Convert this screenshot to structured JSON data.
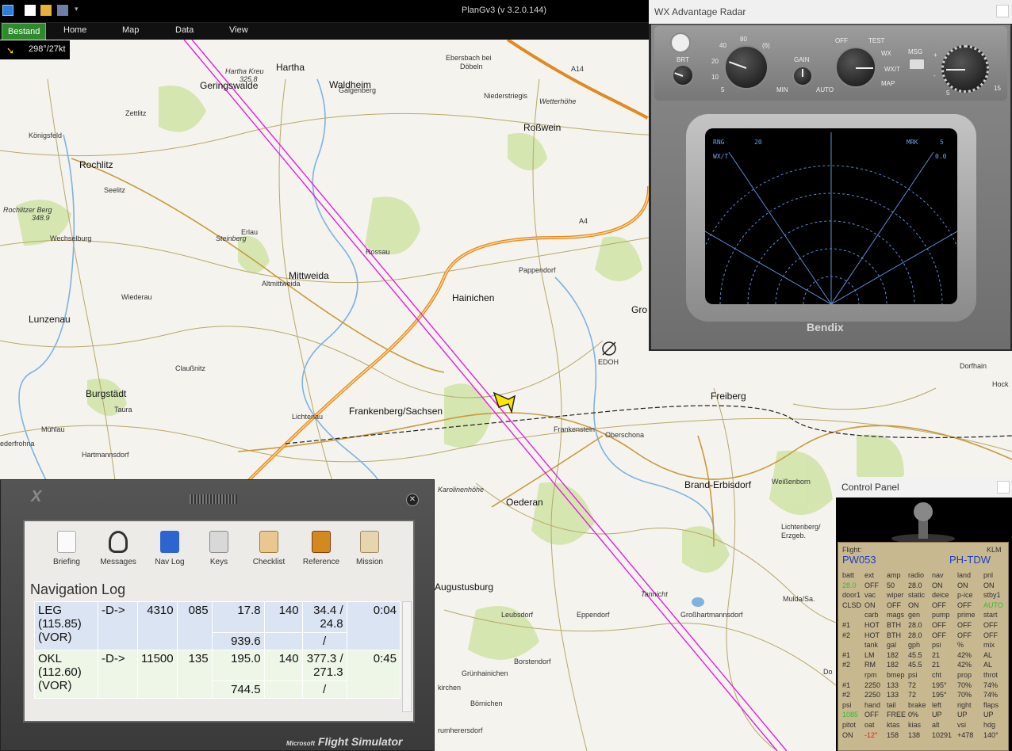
{
  "app": {
    "title": "PlanGv3 (v 3.2.0.144)",
    "ribbon": [
      "Bestand",
      "Home",
      "Map",
      "Data",
      "View"
    ],
    "wind": "298°/27kt"
  },
  "map": {
    "places": [
      {
        "label": "Hartha",
        "key": "hartha"
      },
      {
        "label": "Hartha Kreu",
        "key": "harthakreu"
      },
      {
        "label": "325.8",
        "key": "hk_elev"
      },
      {
        "label": "Ebersbach bei",
        "key": "ebersbach1"
      },
      {
        "label": "Döbeln",
        "key": "ebersbach2"
      },
      {
        "label": "Galgenberg",
        "key": "galgenberg"
      },
      {
        "label": "Geringswalde",
        "key": "geringswalde"
      },
      {
        "label": "Waldheim",
        "key": "waldheim"
      },
      {
        "label": "Niederstriegis",
        "key": "niederstriegis"
      },
      {
        "label": "Wetterhöhe",
        "key": "wetterhohe"
      },
      {
        "label": "Zettlitz",
        "key": "zettlitz"
      },
      {
        "label": "Roßwein",
        "key": "rosswein"
      },
      {
        "label": "Königsfeld",
        "key": "konigsfeld"
      },
      {
        "label": "Rochlitz",
        "key": "rochlitz"
      },
      {
        "label": "Seelitz",
        "key": "seelitz"
      },
      {
        "label": "Rochlitzer Berg",
        "key": "rochlitzerberg"
      },
      {
        "label": "348.9",
        "key": "rb_elev"
      },
      {
        "label": "Erlau",
        "key": "erlau"
      },
      {
        "label": "Steinberg",
        "key": "steinberg"
      },
      {
        "label": "Wechselburg",
        "key": "wechselburg"
      },
      {
        "label": "Rossau",
        "key": "rossau"
      },
      {
        "label": "Mittweida",
        "key": "mittweida"
      },
      {
        "label": "Pappendorf",
        "key": "pappendorf"
      },
      {
        "label": "Hainichen",
        "key": "hainichen"
      },
      {
        "label": "Wiederau",
        "key": "wiederau"
      },
      {
        "label": "Altmittweida",
        "key": "altmittweida"
      },
      {
        "label": "Lunzenau",
        "key": "lunzenau"
      },
      {
        "label": "Claußnitz",
        "key": "claussnitz"
      },
      {
        "label": "EDOH",
        "key": "edoh"
      },
      {
        "label": "Burgstädt",
        "key": "burgstadt"
      },
      {
        "label": "Taura",
        "key": "taura"
      },
      {
        "label": "Lichtenau",
        "key": "lichtenau"
      },
      {
        "label": "Frankenberg/Sachsen",
        "key": "frankenberg"
      },
      {
        "label": "Frankenstein",
        "key": "frankenstein"
      },
      {
        "label": "Oberschona",
        "key": "oberschona"
      },
      {
        "label": "Freiberg",
        "key": "freiberg"
      },
      {
        "label": "Dorfhain",
        "key": "dorfhain"
      },
      {
        "label": "Mühlau",
        "key": "muhlau"
      },
      {
        "label": "ederfrohna",
        "key": "ederfrohna"
      },
      {
        "label": "Hartmannsdorf",
        "key": "hartmannsdorf"
      },
      {
        "label": "Brand-Erbisdorf",
        "key": "branderbisdorf"
      },
      {
        "label": "Weißenborn",
        "key": "weissenborn"
      },
      {
        "label": "Karolinenhöhe",
        "key": "karolinenhohe"
      },
      {
        "label": "Oederan",
        "key": "oederan"
      },
      {
        "label": "Lichtenberg/",
        "key": "lichtenberg1"
      },
      {
        "label": "Erzgeb.",
        "key": "lichtenberg2"
      },
      {
        "label": "Augustusburg",
        "key": "augustusburg"
      },
      {
        "label": "Tannicht",
        "key": "tannicht"
      },
      {
        "label": "Leubsdorf",
        "key": "leubsdorf"
      },
      {
        "label": "Eppendorf",
        "key": "eppendorf"
      },
      {
        "label": "Großhartmannsdorf",
        "key": "grosshartmannsdorf"
      },
      {
        "label": "Mulda/Sa.",
        "key": "mulda"
      },
      {
        "label": "Borstendorf",
        "key": "borstendorf"
      },
      {
        "label": "Grünhainichen",
        "key": "grunhainichen"
      },
      {
        "label": "kirchen",
        "key": "kirchen"
      },
      {
        "label": "Börnichen",
        "key": "bornichen"
      },
      {
        "label": "rumherersdorf",
        "key": "rumherersdorf"
      },
      {
        "label": "Gro",
        "key": "gro"
      },
      {
        "label": "Hock",
        "key": "hock"
      },
      {
        "label": "Do",
        "key": "do"
      },
      {
        "label": "A14",
        "key": "a14"
      },
      {
        "label": "A4",
        "key": "a4"
      }
    ]
  },
  "radar": {
    "window_title": "WX Advantage Radar",
    "labels": {
      "brt": "BRT",
      "gain": "GAIN",
      "min": "MIN",
      "auto": "AUTO",
      "off": "OFF",
      "test": "TEST",
      "wx": "WX",
      "wxt": "WX/T",
      "map": "MAP",
      "msg": "MSG",
      "plus": "+",
      "minus": "-",
      "r40": "40",
      "r80": "80",
      "r6": "(6)",
      "r20": "20",
      "r10": "10",
      "r5": "5",
      "t5": "5",
      "t15": "15"
    },
    "screen": {
      "rng_label": "RNG",
      "rng_value": "20",
      "mode": "WX/T",
      "mrk_label": "MRK",
      "mrk_value": "5",
      "tilt": "0.0"
    },
    "brand": "Bendix"
  },
  "fsx": {
    "toolbar": [
      {
        "label": "Briefing",
        "key": "briefing"
      },
      {
        "label": "Messages",
        "key": "messages"
      },
      {
        "label": "Nav Log",
        "key": "navlog"
      },
      {
        "label": "Keys",
        "key": "keys"
      },
      {
        "label": "Checklist",
        "key": "checklist"
      },
      {
        "label": "Reference",
        "key": "reference"
      },
      {
        "label": "Mission",
        "key": "mission"
      }
    ],
    "section_title": "Navigation Log",
    "rows": [
      {
        "wp": "LEG (115.85) (VOR)",
        "dir": "-D->",
        "alt": "4310",
        "hdg": "085",
        "dist": "17.8",
        "dist2": "939.6",
        "spd": "140",
        "fuel": "34.4 / 24.8",
        "fuel2": "/",
        "time": "0:04"
      },
      {
        "wp": "OKL (112.60) (VOR)",
        "dir": "-D->",
        "alt": "11500",
        "hdg": "135",
        "dist": "195.0",
        "dist2": "744.5",
        "spd": "140",
        "fuel": "377.3 / 271.3",
        "fuel2": "/",
        "time": "0:45"
      }
    ],
    "brand_small": "Microsoft",
    "brand": "Flight Simulator"
  },
  "control_panel": {
    "window_title": "Control Panel",
    "flight_label": "Flight:",
    "airline": "KLM",
    "flight_no": "PW053",
    "reg": "PH-TDW",
    "rows": [
      [
        "batt",
        "ext",
        "amp",
        "radio",
        "nav",
        "land",
        "pnl"
      ],
      [
        "28.0",
        "OFF",
        "50",
        "28.0",
        "ON",
        "ON",
        "ON"
      ],
      [
        "door1",
        "vac",
        "wiper",
        "static",
        "deice",
        "p-ice",
        "stby1"
      ],
      [
        "CLSD",
        "ON",
        "OFF",
        "ON",
        "OFF",
        "OFF",
        "AUTO"
      ],
      [
        "",
        "carb",
        "mags",
        "gen",
        "pump",
        "prime",
        "start"
      ],
      [
        "#1",
        "HOT",
        "BTH",
        "28.0",
        "OFF",
        "OFF",
        "OFF"
      ],
      [
        "#2",
        "HOT",
        "BTH",
        "28.0",
        "OFF",
        "OFF",
        "OFF"
      ],
      [
        "",
        "tank",
        "gal",
        "gph",
        "psi",
        "%",
        "mix"
      ],
      [
        "#1",
        "LM",
        "182",
        "45.5",
        "21",
        "42%",
        "AL"
      ],
      [
        "#2",
        "RM",
        "182",
        "45.5",
        "21",
        "42%",
        "AL"
      ],
      [
        "",
        "rpm",
        "bmep",
        "psi",
        "cht",
        "prop",
        "throt"
      ],
      [
        "#1",
        "2250",
        "133",
        "72",
        "195°",
        "70%",
        "74%"
      ],
      [
        "#2",
        "2250",
        "133",
        "72",
        "195°",
        "70%",
        "74%"
      ],
      [
        "psi",
        "hand",
        "tail",
        "brake",
        "left",
        "right",
        "flaps"
      ],
      [
        "1085",
        "OFF",
        "FREE",
        "0%",
        "UP",
        "UP",
        "UP"
      ],
      [
        "pitot",
        "oat",
        "ktas",
        "kias",
        "alt",
        "vsi",
        "hdg"
      ],
      [
        "ON",
        "-12°",
        "158",
        "138",
        "10291",
        "+478",
        "140°"
      ]
    ],
    "colors": {
      "green": "#2fbf2f",
      "red": "#e02020",
      "blue": "#1c3ec8"
    }
  }
}
